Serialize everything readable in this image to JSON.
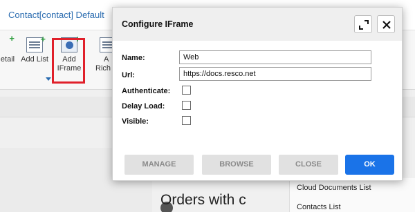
{
  "background": {
    "window_title": "Contact[contact] Default",
    "ribbon": {
      "detail_label": "etail",
      "add_list_label": "Add List",
      "add_iframe_label_line1": "Add",
      "add_iframe_label_line2": "IFrame",
      "partial_label_line1": "A",
      "partial_label_line2": "Rich"
    },
    "orders_text": "Orders with c",
    "right_list": [
      "Cloud Documents List",
      "Contacts List"
    ]
  },
  "dialog": {
    "title": "Configure IFrame",
    "fields": {
      "name_label": "Name:",
      "name_value": "Web",
      "url_label": "Url:",
      "url_value": "https://docs.resco.net",
      "authenticate_label": "Authenticate:",
      "authenticate_checked": false,
      "delay_load_label": "Delay Load:",
      "delay_load_checked": false,
      "visible_label": "Visible:",
      "visible_checked": false
    },
    "buttons": {
      "manage": "MANAGE",
      "browse": "BROWSE",
      "close": "CLOSE",
      "ok": "OK"
    }
  },
  "colors": {
    "accent": "#1a73e8",
    "highlight": "#e0202a",
    "title_link": "#2b6cb0"
  }
}
